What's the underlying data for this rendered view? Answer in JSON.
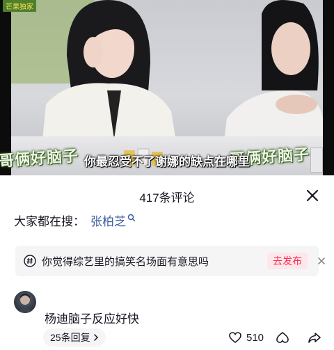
{
  "video": {
    "subtitle": "你最忍受不了谢娜的缺点在哪里",
    "show_logo": "哥俩好脑子",
    "corner_tag": "芒果独家"
  },
  "comments_panel": {
    "title": "417条评论",
    "search_prefix": "大家都在搜：",
    "search_term": "张柏芝",
    "topic_prompt": "你觉得综艺里的搞笑名场面有意思吗",
    "publish_label": "去发布",
    "comment": {
      "text": "杨迪脑子反应好快",
      "replies_label": "25条回复",
      "like_count": "510"
    }
  },
  "colors": {
    "accent": "#fe2c55",
    "link": "#3a5e9c",
    "text": "#161823",
    "chip_bg": "#f5f5f6"
  }
}
